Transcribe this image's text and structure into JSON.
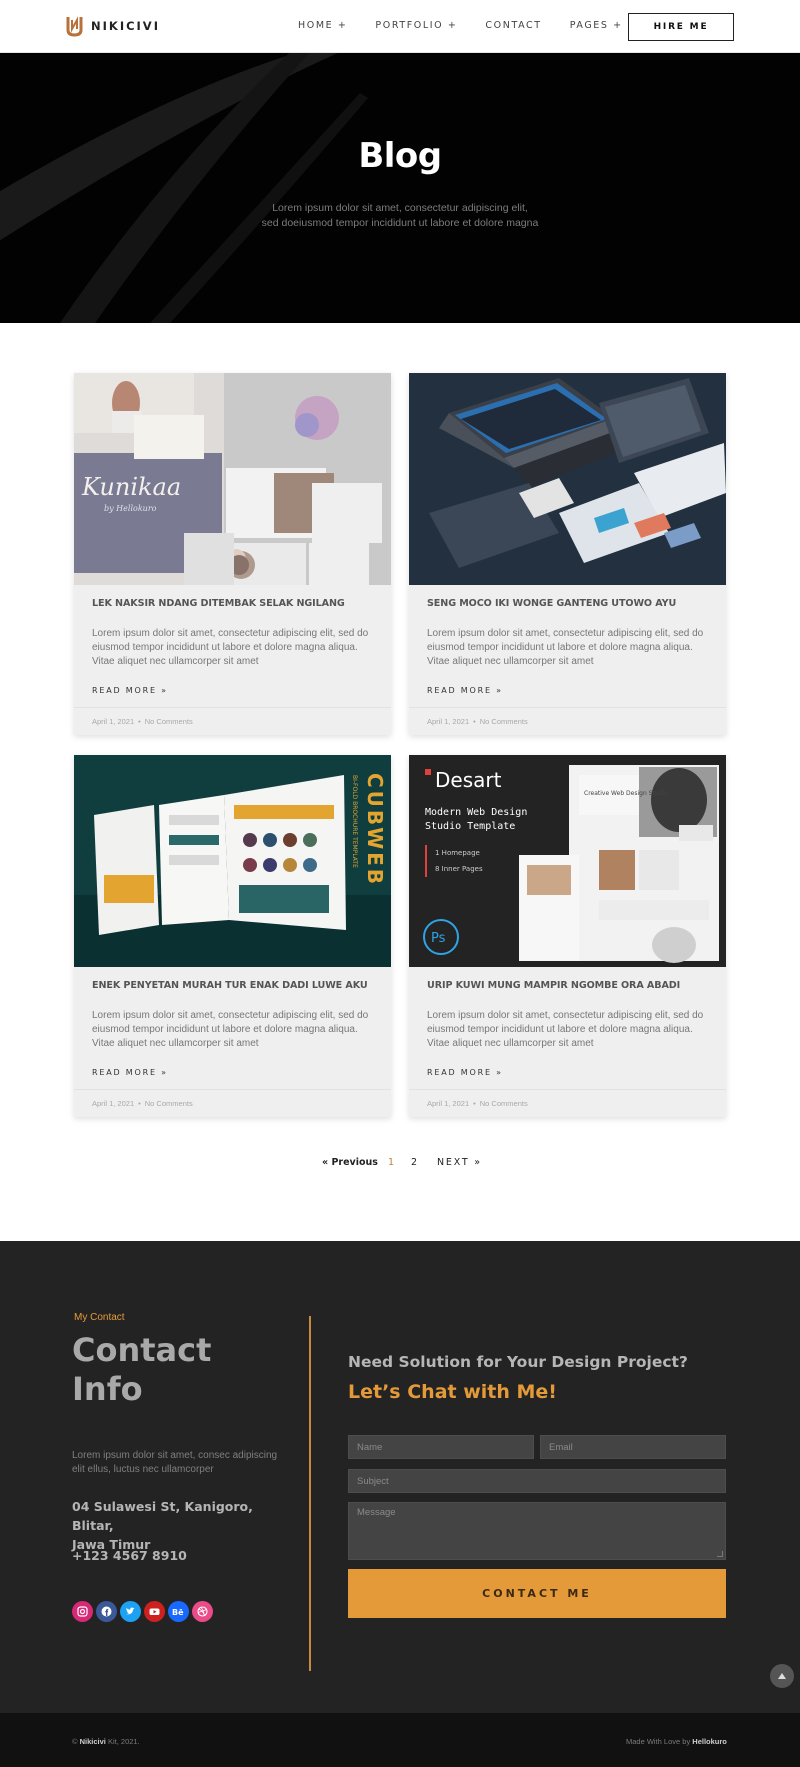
{
  "brand": {
    "name": "NIKICIVI",
    "accent": "#e59a3a",
    "logo_color": "#b8713a"
  },
  "nav": {
    "items": [
      {
        "label": "HOME +"
      },
      {
        "label": "PORTFOLIO +"
      },
      {
        "label": "CONTACT"
      },
      {
        "label": "PAGES +"
      }
    ],
    "cta": "HIRE ME"
  },
  "hero": {
    "title": "Blog",
    "subtitle_line1": "Lorem ipsum dolor sit amet, consectetur adipiscing elit,",
    "subtitle_line2": "sed doeiusmod tempor incididunt ut labore et dolore magna"
  },
  "posts": [
    {
      "title": "LEK NAKSIR NDANG DITEMBAK SELAK NGILANG",
      "excerpt": "Lorem ipsum dolor sit amet, consectetur adipiscing elit, sed do eiusmod tempor incididunt ut labore et dolore magna aliqua. Vitae aliquet nec ullamcorper sit amet",
      "read_more": "READ MORE »",
      "date": "April 1, 2021",
      "comments": "No Comments",
      "image_text": {
        "brand": "Kunikaa",
        "by": "by Hellokuro"
      }
    },
    {
      "title": "SENG MOCO IKI WONGE GANTENG UTOWO AYU",
      "excerpt": "Lorem ipsum dolor sit amet, consectetur adipiscing elit, sed do eiusmod tempor incididunt ut labore et dolore magna aliqua. Vitae aliquet nec ullamcorper sit amet",
      "read_more": "READ MORE »",
      "date": "April 1, 2021",
      "comments": "No Comments"
    },
    {
      "title": "ENEK PENYETAN MURAH TUR ENAK DADI LUWE AKU",
      "excerpt": "Lorem ipsum dolor sit amet, consectetur adipiscing elit, sed do eiusmod tempor incididunt ut labore et dolore magna aliqua. Vitae aliquet nec ullamcorper sit amet",
      "read_more": "READ MORE »",
      "date": "April 1, 2021",
      "comments": "No Comments",
      "image_text": {
        "brand": "CUBWEB",
        "tag": "BI-FOLD BROCHURE TEMPLATE"
      }
    },
    {
      "title": "URIP KUWI MUNG MAMPIR NGOMBE ORA ABADI",
      "excerpt": "Lorem ipsum dolor sit amet, consectetur adipiscing elit, sed do eiusmod tempor incididunt ut labore et dolore magna aliqua. Vitae aliquet nec ullamcorper sit amet",
      "read_more": "READ MORE »",
      "date": "April 1, 2021",
      "comments": "No Comments",
      "image_text": {
        "brand": "Desart",
        "headline1": "Modern Web Design",
        "headline2": "Studio Template",
        "bullet1": "1 Homepage",
        "bullet2": "8 Inner Pages",
        "ps": "Ps",
        "mock": "Creative Web Design Studio"
      }
    }
  ],
  "pagination": {
    "prev": "« Previous",
    "current": "1",
    "page2": "2",
    "next": "NEXT »"
  },
  "contact": {
    "eyebrow": "My Contact",
    "heading_line1": "Contact",
    "heading_line2": "Info",
    "description": "Lorem ipsum dolor sit amet, consec adipiscing elit ellus, luctus nec ullamcorper",
    "address_line1": "04 Sulawesi St, Kanigoro, Blitar,",
    "address_line2": "Jawa Timur",
    "phone": "+123 4567 8910",
    "socials": [
      {
        "icon": "instagram-icon",
        "color": "#d62976"
      },
      {
        "icon": "facebook-icon",
        "color": "#3b5998"
      },
      {
        "icon": "twitter-icon",
        "color": "#1da1f2"
      },
      {
        "icon": "youtube-icon",
        "color": "#cd201f"
      },
      {
        "icon": "behance-icon",
        "color": "#1769ff"
      },
      {
        "icon": "dribbble-icon",
        "color": "#ea4c89"
      }
    ],
    "question": "Need Solution for Your Design Project?",
    "cta_line": "Let’s Chat with Me!",
    "form": {
      "name_placeholder": "Name",
      "email_placeholder": "Email",
      "subject_placeholder": "Subject",
      "message_placeholder": "Message",
      "submit": "CONTACT ME"
    }
  },
  "footer": {
    "copyright_prefix": "©",
    "copyright_brand": "Nikicivi",
    "copyright_suffix": "Kit, 2021.",
    "made_prefix": "Made With Love by",
    "made_brand": "Hellokuro"
  }
}
